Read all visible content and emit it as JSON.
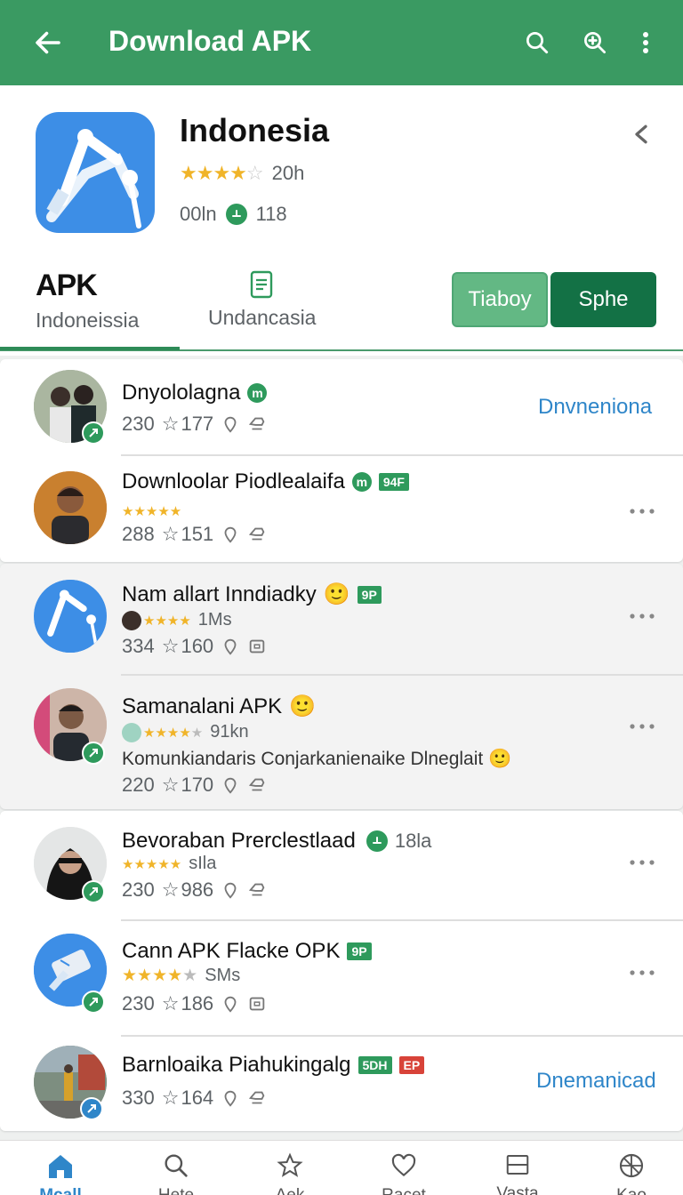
{
  "appbar": {
    "title": "Download APK",
    "back_icon": "arrow-back-icon",
    "actions": [
      "search-icon",
      "zoom-search-icon",
      "more-vert-icon"
    ]
  },
  "header": {
    "app_name": "Indonesia",
    "rating_stars": 4.5,
    "rating_text": "20h",
    "size_text": "00ln",
    "downloads_text": "118",
    "tabs": [
      {
        "big": "APK",
        "sub": "Indoneissia"
      },
      {
        "icon": "document-icon",
        "sub": "Undancasia"
      }
    ],
    "buttons": {
      "secondary": "Tiaboy",
      "primary": "Sphe"
    },
    "colors": {
      "appbar": "#3a9a62",
      "primary_button": "#137145",
      "secondary_button": "#63b884",
      "link": "#2f86c9"
    }
  },
  "list": [
    {
      "name": "Dnyololagna",
      "badge": "m",
      "stats": [
        "230",
        "177"
      ],
      "action": "Dnvneniona"
    },
    {
      "name": "Downloolar Piodlealaifa",
      "badge": "m",
      "tag": "94F",
      "stars": 5,
      "stats": [
        "288",
        "151"
      ]
    },
    {
      "name": "Nam allart Inndiadky",
      "emoji": "🙂",
      "tag": "9P",
      "stars": 4,
      "sub_text": "1Ms",
      "stats": [
        "334",
        "160"
      ]
    },
    {
      "name": "Samanalani APK",
      "emoji": "🙂",
      "stars": 4,
      "sub_text": "91kn",
      "desc": "Komunkiandaris Conjarkanienaike Dlneglait",
      "stats": [
        "220",
        "170"
      ]
    },
    {
      "name": "Bevoraban Prerclestlaad",
      "sub_badge": "18la",
      "stars": 5,
      "sub_text": "sIla",
      "stats": [
        "230",
        "986"
      ]
    },
    {
      "name": "Cann APK Flacke OPK",
      "tag": "9P",
      "stars": 4,
      "sub_text": "SMs",
      "stats": [
        "230",
        "186"
      ]
    },
    {
      "name": "Barnloaika Piahukingalg",
      "tag": "5DH",
      "tag2": "EP",
      "stats": [
        "330",
        "164"
      ],
      "action": "Dnemanicad"
    }
  ],
  "bottomnav": [
    {
      "label": "Mcall",
      "icon": "home-icon",
      "active": true
    },
    {
      "label": "Hete",
      "icon": "search-icon"
    },
    {
      "label": "Aek",
      "icon": "star-icon"
    },
    {
      "label": "Racet",
      "icon": "heart-icon"
    },
    {
      "label": "Vasta",
      "icon": "box-icon"
    },
    {
      "label": "Kao",
      "icon": "globe-icon"
    }
  ]
}
